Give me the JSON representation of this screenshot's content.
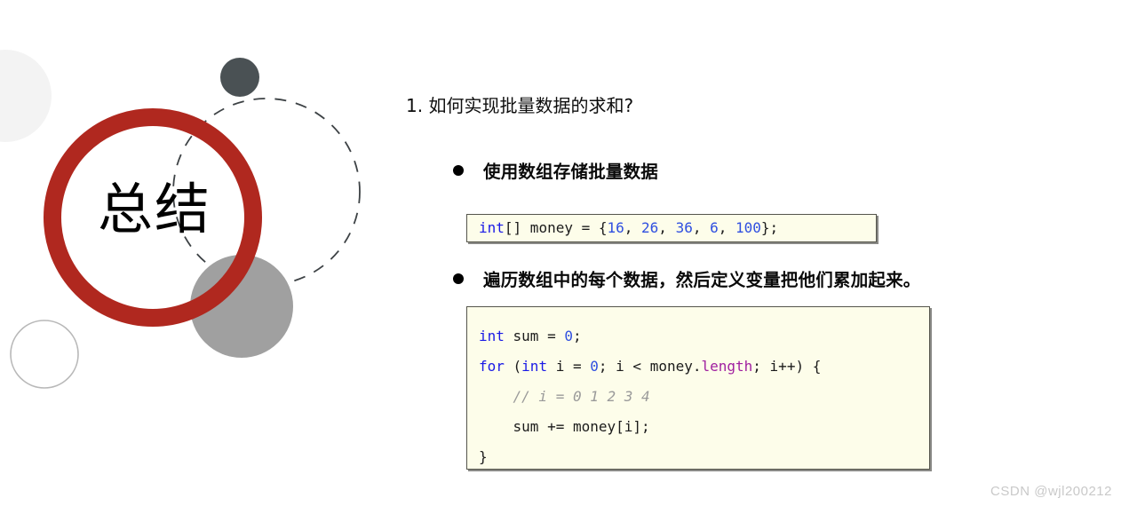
{
  "slide": {
    "badge": {
      "label": "总结"
    },
    "question": "1. 如何实现批量数据的求和?",
    "bullets": [
      {
        "text": "使用数组存储批量数据"
      },
      {
        "text": "遍历数组中的每个数据，然后定义变量把他们累加起来。"
      }
    ],
    "code_blocks": [
      {
        "id": "array-declaration",
        "lines": [
          {
            "tokens": [
              {
                "t": "int",
                "k": "kw"
              },
              {
                "t": "[] money = {",
                "k": "plain"
              },
              {
                "t": "16",
                "k": "num"
              },
              {
                "t": ", ",
                "k": "plain"
              },
              {
                "t": "26",
                "k": "num"
              },
              {
                "t": ", ",
                "k": "plain"
              },
              {
                "t": "36",
                "k": "num"
              },
              {
                "t": ", ",
                "k": "plain"
              },
              {
                "t": "6",
                "k": "num"
              },
              {
                "t": ", ",
                "k": "plain"
              },
              {
                "t": "100",
                "k": "num"
              },
              {
                "t": "};",
                "k": "plain"
              }
            ]
          }
        ]
      },
      {
        "id": "sum-loop",
        "lines": [
          {
            "tokens": [
              {
                "t": "int",
                "k": "kw"
              },
              {
                "t": " sum = ",
                "k": "plain"
              },
              {
                "t": "0",
                "k": "num"
              },
              {
                "t": ";",
                "k": "plain"
              }
            ]
          },
          {
            "tokens": [
              {
                "t": "for",
                "k": "kw"
              },
              {
                "t": " (",
                "k": "plain"
              },
              {
                "t": "int",
                "k": "kw"
              },
              {
                "t": " i = ",
                "k": "plain"
              },
              {
                "t": "0",
                "k": "num"
              },
              {
                "t": "; i < money.",
                "k": "plain"
              },
              {
                "t": "length",
                "k": "prop"
              },
              {
                "t": "; i++) {",
                "k": "plain"
              }
            ]
          },
          {
            "tokens": [
              {
                "t": "    // i = 0 1 2 3 4",
                "k": "cmt"
              }
            ]
          },
          {
            "tokens": [
              {
                "t": "    sum += money[i];",
                "k": "plain"
              }
            ]
          },
          {
            "tokens": [
              {
                "t": "}",
                "k": "plain"
              }
            ]
          }
        ]
      }
    ],
    "watermark": "CSDN @wjl200212",
    "colors": {
      "accent_red": "#b0281f",
      "dark_dot": "#4a5154",
      "gray_circle": "#a0a0a0",
      "pale_circle": "#f3f3f3",
      "outline_circle": "#b8b8b8",
      "dashed_circle": "#3d4245",
      "code_bg": "#fdfdea",
      "code_border": "#55554c",
      "keyword": "#1a1ae6",
      "number": "#2f4fe0",
      "property": "#a020a0",
      "comment": "#9a9a9a",
      "watermark": "#c9c9c9"
    }
  }
}
